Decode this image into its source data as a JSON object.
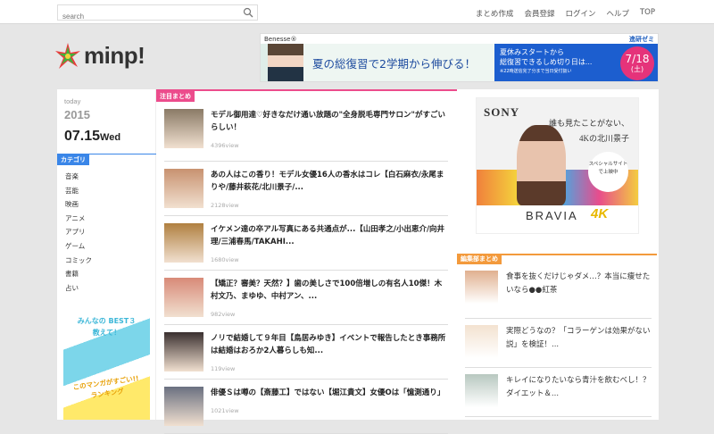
{
  "header": {
    "search_placeholder": "search",
    "nav": [
      "まとめ作成",
      "会員登録",
      "ログイン",
      "ヘルプ",
      "TOP"
    ]
  },
  "logo": {
    "text": "minp!"
  },
  "top_ad": {
    "brand": "Benesse®",
    "sub": "進研ゼミ",
    "headline": "夏の総復習で2学期から伸びる！",
    "side1": "夏休みスタートから",
    "side2": "総復習できるしめ切り日は...",
    "note": "※22時送信完了分まで当日受付扱い",
    "date": "7/18",
    "day": "(土)"
  },
  "date": {
    "label": "today",
    "year": "2015",
    "day": "07.15",
    "weekday": "Wed"
  },
  "categories": {
    "title": "カテゴリ",
    "items": [
      "音楽",
      "芸能",
      "映画",
      "アニメ",
      "アプリ",
      "ゲーム",
      "コミック",
      "書籍",
      "占い"
    ]
  },
  "banner": {
    "line1": "みんなの BEST３",
    "line2": "教えて！",
    "line3": "このマンガがすごい!!",
    "line4": "ランキング"
  },
  "featured": {
    "title": "注目まとめ",
    "items": [
      {
        "title": "モデル御用達♡好きなだけ通い放題の\"全身脱毛専門サロン\"がすごいらしい！",
        "views": "4396view",
        "color": "#8a7a66"
      },
      {
        "title": "あの人はこの香り！モデル女優16人の香水はコレ【白石麻衣/永尾まりや/藤井萩花/北川景子/...",
        "views": "2128view",
        "color": "#c89270"
      },
      {
        "title": "イケメン達の卒アル写真にある共通点が...【山田孝之/小出恵介/向井理/三浦春馬/TAKAHI...",
        "views": "1680view",
        "color": "#b08040"
      },
      {
        "title": "【矯正？審美？天然？】歯の美しさで100倍増しの有名人10傑！木村文乃、まゆゆ、中村アン、...",
        "views": "982view",
        "color": "#d88a78"
      },
      {
        "title": "ノリで結婚して９年目【鳥居みゆき】イベントで報告したとき事務所は結婚はおろか2人暮らしも知...",
        "views": "119view",
        "color": "#3a3030"
      },
      {
        "title": "俳優Ｓは噂の【斎藤工】ではない【堀江貴文】女優Oは「憶測通り」",
        "views": "1021view",
        "color": "#6a7080"
      }
    ]
  },
  "sony_ad": {
    "brand": "SONY",
    "copy1": "誰も見たことがない、",
    "copy2": "4Kの北川景子",
    "bubble": "スペシャルサイトで上映中",
    "product": "BRAVIA",
    "k4": "4K"
  },
  "editorial": {
    "title": "編集部まとめ",
    "items": [
      {
        "title": "食事を抜くだけじゃダメ…？本当に痩せたいなら●●紅茶",
        "color": "#e0b090"
      },
      {
        "title": "実際どうなの？「コラーゲンは効果がない説」を検証！...",
        "color": "#f3e2d0"
      },
      {
        "title": "キレイになりたいなら青汁を飲むべし！？ダイエット＆...",
        "color": "#b8c8c0"
      }
    ]
  }
}
